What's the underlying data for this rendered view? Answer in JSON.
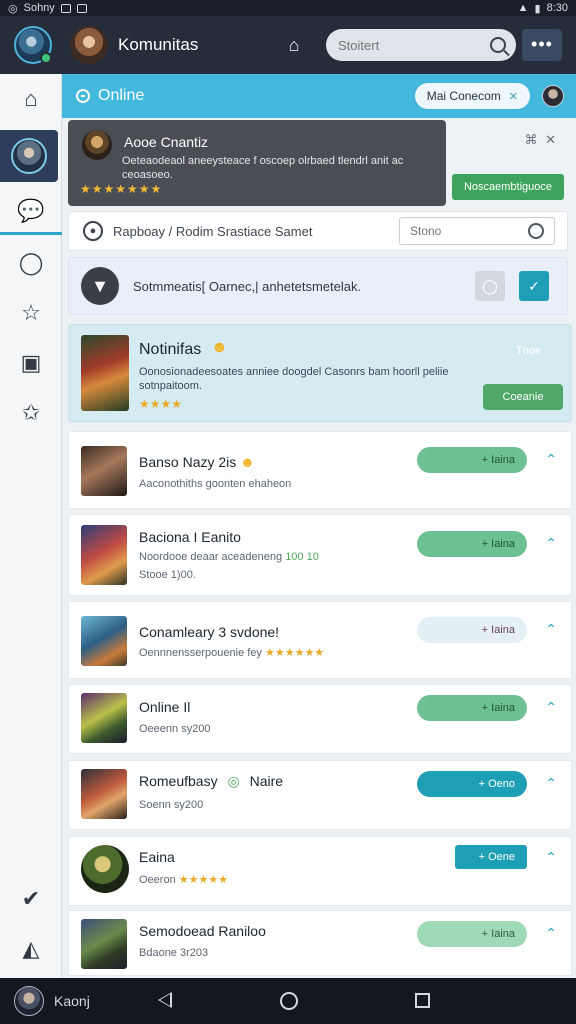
{
  "statusbar": {
    "left_text": "Sohny",
    "right_text": "8:30"
  },
  "header": {
    "title": "Komunitas",
    "search_placeholder": "Stoitert",
    "more_icon": "•••"
  },
  "online_bar": {
    "label": "Online",
    "button_label": "Mai Conecom"
  },
  "notice": {
    "title": "Aooe Cnantiz",
    "text": "Oeteaodeaol aneeysteace f oscoep olrbaed tlendrl anit ac ceoasoeo.",
    "stars": "★★★★★★★",
    "icons": "⌘ ✕",
    "button_label": "Noscaembtiguoce"
  },
  "breadcrumb": {
    "text": "Rapboay / Rodim Srastiace Samet",
    "search_placeholder": "Stono"
  },
  "status_row": {
    "text": "Sotmmeatis[ Oarnec,| anhetetsmetelak."
  },
  "featured": {
    "title": "Notinifas",
    "description": "Oonosionadeesoates anniee doogdel Casonrs bam hoorll peliie sotnpaitoom.",
    "stars": "★★★★",
    "tag": "Tnoe",
    "button_label": "Coeanie"
  },
  "rows": [
    {
      "title": "Banso Nazy 2is",
      "emoji": "😼",
      "sub": "Aaconothiths goonten ehaheon",
      "sub2": "",
      "button": "+ Iaina",
      "button_style": "green"
    },
    {
      "title": "Baciona I Eanito",
      "emoji": "",
      "sub": "Noordooe deaar aceadeneng",
      "sub_extra": "100 10",
      "sub2": "Stooe 1)00.",
      "button": "+ Iaina",
      "button_style": "green"
    },
    {
      "title": "Conamleary 3 svdone!",
      "emoji": "",
      "sub": "Oennnensserpouenie fey",
      "stars": "★★★★★★",
      "sub2": "",
      "button": "+ Iaina",
      "button_style": "pale"
    },
    {
      "title": "Online Il",
      "emoji": "",
      "sub": "Oeeenn sy200",
      "sub2": "",
      "button": "+ Iaina",
      "button_style": "green"
    },
    {
      "title": "Romeufbasy",
      "emoji": "◎",
      "title_extra": "Naire",
      "sub": "Soenn sy200",
      "sub2": "",
      "button": "+ Oeno",
      "button_style": "teal"
    },
    {
      "title": "Eaina",
      "emoji": "",
      "sub": "Oeeron",
      "stars": "★★★★★",
      "sub2": "",
      "button": "+ Oene",
      "button_style": "teal-small"
    },
    {
      "title": "Semodoead Raniloo",
      "emoji": "",
      "sub": "Bdaone 3r203",
      "sub2": "",
      "button": "+ Iaina",
      "button_style": "pale-green"
    }
  ],
  "navbar": {
    "label": "Kaonj"
  },
  "colors": {
    "accent": "#44b8dc",
    "header": "#262d3a",
    "green": "#4fa868",
    "teal": "#1f9fb5"
  }
}
